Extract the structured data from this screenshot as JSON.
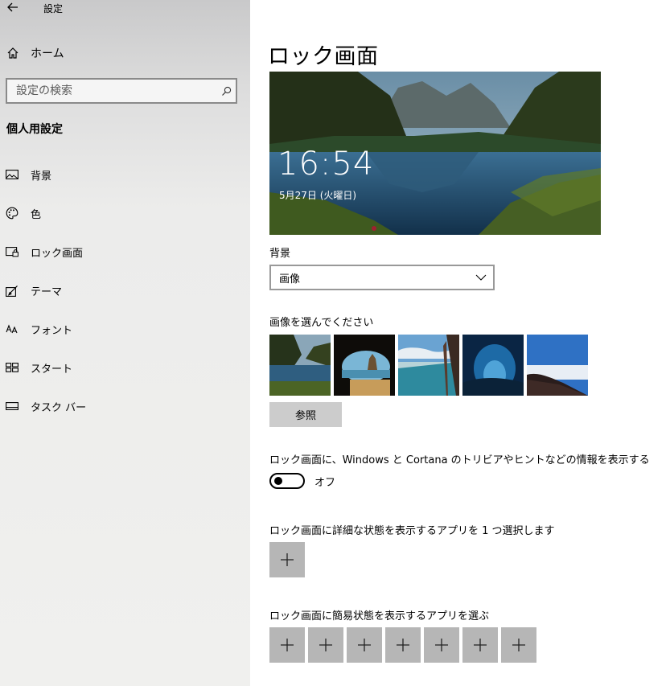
{
  "window": {
    "title": "設定"
  },
  "sidebar": {
    "home_label": "ホーム",
    "search_placeholder": "設定の検索",
    "section_heading": "個人用設定",
    "items": [
      {
        "label": "背景",
        "icon": "picture-icon"
      },
      {
        "label": "色",
        "icon": "palette-icon"
      },
      {
        "label": "ロック画面",
        "icon": "lock-screen-icon"
      },
      {
        "label": "テーマ",
        "icon": "theme-icon"
      },
      {
        "label": "フォント",
        "icon": "font-icon"
      },
      {
        "label": "スタート",
        "icon": "start-icon"
      },
      {
        "label": "タスク バー",
        "icon": "taskbar-icon"
      }
    ]
  },
  "main": {
    "title": "ロック画面",
    "preview": {
      "time": "16:54",
      "date": "5月27日 (火曜日)"
    },
    "background_label": "背景",
    "background_value": "画像",
    "choose_image_label": "画像を選んでください",
    "browse_label": "参照",
    "fun_facts_label": "ロック画面に、Windows と Cortana のトリビアやヒントなどの情報を表示する",
    "fun_facts_state": "オフ",
    "detailed_app_label": "ロック画面に詳細な状態を表示するアプリを 1 つ選択します",
    "quick_apps_label": "ロック画面に簡易状態を表示するアプリを選ぶ"
  },
  "colors": {
    "sidebar_bg": "#ececeb",
    "button_gray": "#cccccc",
    "plus_gray": "#b6b6b6"
  }
}
